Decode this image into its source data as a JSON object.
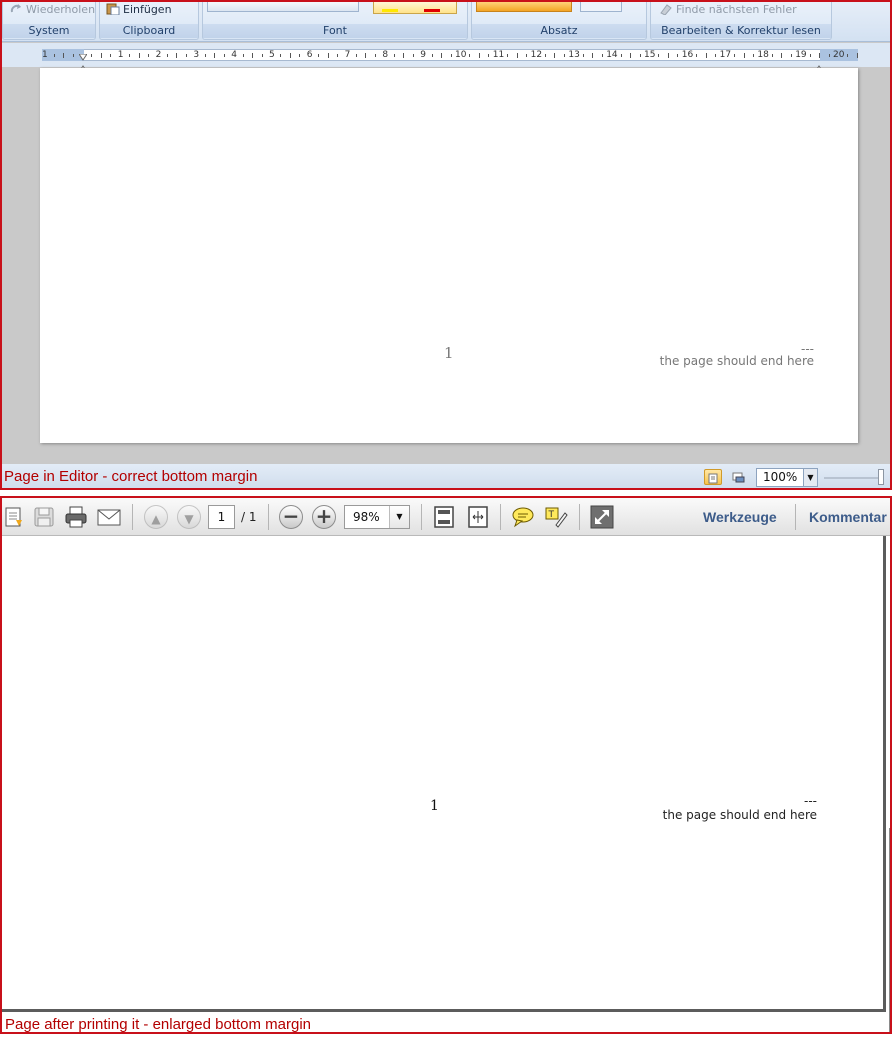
{
  "editor": {
    "ribbon": {
      "groups": [
        {
          "label": "System",
          "item": "Wiederholen"
        },
        {
          "label": "Clipboard",
          "item": "Einfügen"
        },
        {
          "label": "Font"
        },
        {
          "label": "Absatz"
        },
        {
          "label": "Bearbeiten & Korrektur lesen",
          "item": "Finde nächsten Fehler"
        }
      ]
    },
    "ruler": {
      "numbers": [
        "1",
        "1",
        "2",
        "3",
        "4",
        "5",
        "6",
        "7",
        "8",
        "9",
        "10",
        "11",
        "12",
        "13",
        "14",
        "15",
        "16",
        "17",
        "18",
        "19",
        "20"
      ]
    },
    "page": {
      "page_number": "1",
      "dash": "---",
      "end_text": "the page should end here"
    },
    "status": {
      "caption": "Page in Editor - correct bottom margin",
      "zoom": "100%"
    }
  },
  "viewer": {
    "toolbar": {
      "page_current": "1",
      "page_total": "/ 1",
      "zoom": "98%",
      "tools_label": "Werkzeuge",
      "comment_label": "Kommentar"
    },
    "page": {
      "page_number": "1",
      "dash": "---",
      "end_text": "the page should end here"
    },
    "caption": "Page after printing it - enlarged bottom margin"
  },
  "colors": {
    "caption_red": "#b30000",
    "panel_border": "#c8101a",
    "ribbon_blue": "#d3e1f2",
    "toolbar_link": "#3d5c8a"
  }
}
